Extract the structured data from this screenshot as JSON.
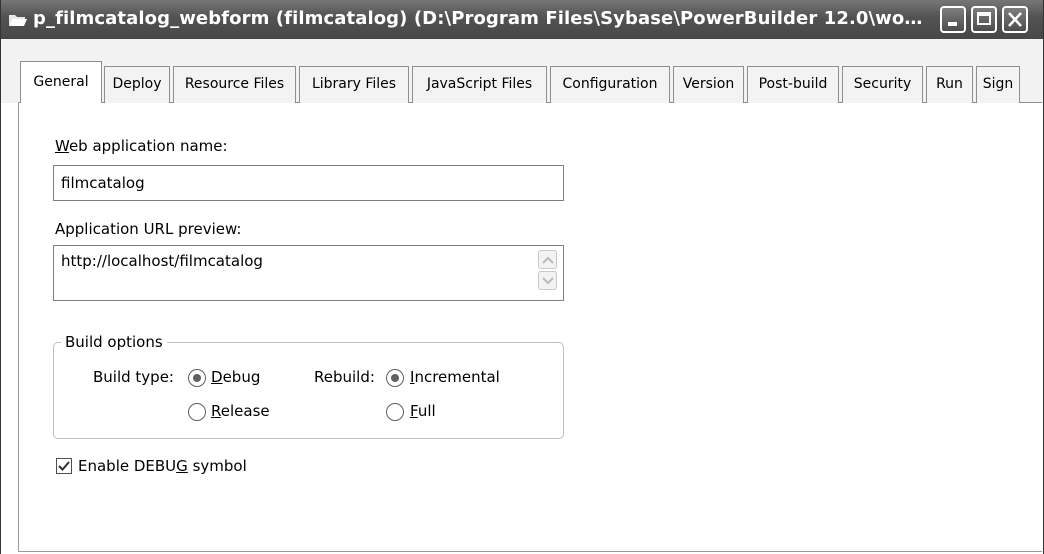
{
  "window": {
    "title": "p_filmcatalog_webform (filmcatalog) (D:\\Program Files\\Sybase\\PowerBuilder 12.0\\wo…"
  },
  "tabs": [
    {
      "label": "General"
    },
    {
      "label": "Deploy"
    },
    {
      "label": "Resource Files"
    },
    {
      "label": "Library Files"
    },
    {
      "label": "JavaScript Files"
    },
    {
      "label": "Configuration"
    },
    {
      "label": "Version"
    },
    {
      "label": "Post-build"
    },
    {
      "label": "Security"
    },
    {
      "label": "Run"
    },
    {
      "label": "Sign"
    }
  ],
  "general": {
    "web_app_label_mnemonic": "W",
    "web_app_label_rest": "eb application name:",
    "web_app_value": "filmcatalog",
    "url_label": "Application URL preview:",
    "url_value": "http://localhost/filmcatalog",
    "build_options_label": "Build options",
    "build_type_label": "Build type:",
    "debug_mnemonic": "D",
    "debug_rest": "ebug",
    "release_mnemonic": "R",
    "release_rest": "elease",
    "rebuild_label": "Rebuild:",
    "incremental_mnemonic": "I",
    "incremental_rest": "ncremental",
    "full_mnemonic": "F",
    "full_rest": "ull",
    "debug_symbol_pre": "Enable DEBU",
    "debug_symbol_mnemonic": "G",
    "debug_symbol_post": " symbol"
  },
  "state": {
    "build_type": "Debug",
    "rebuild": "Incremental",
    "enable_debug_symbol": true
  }
}
